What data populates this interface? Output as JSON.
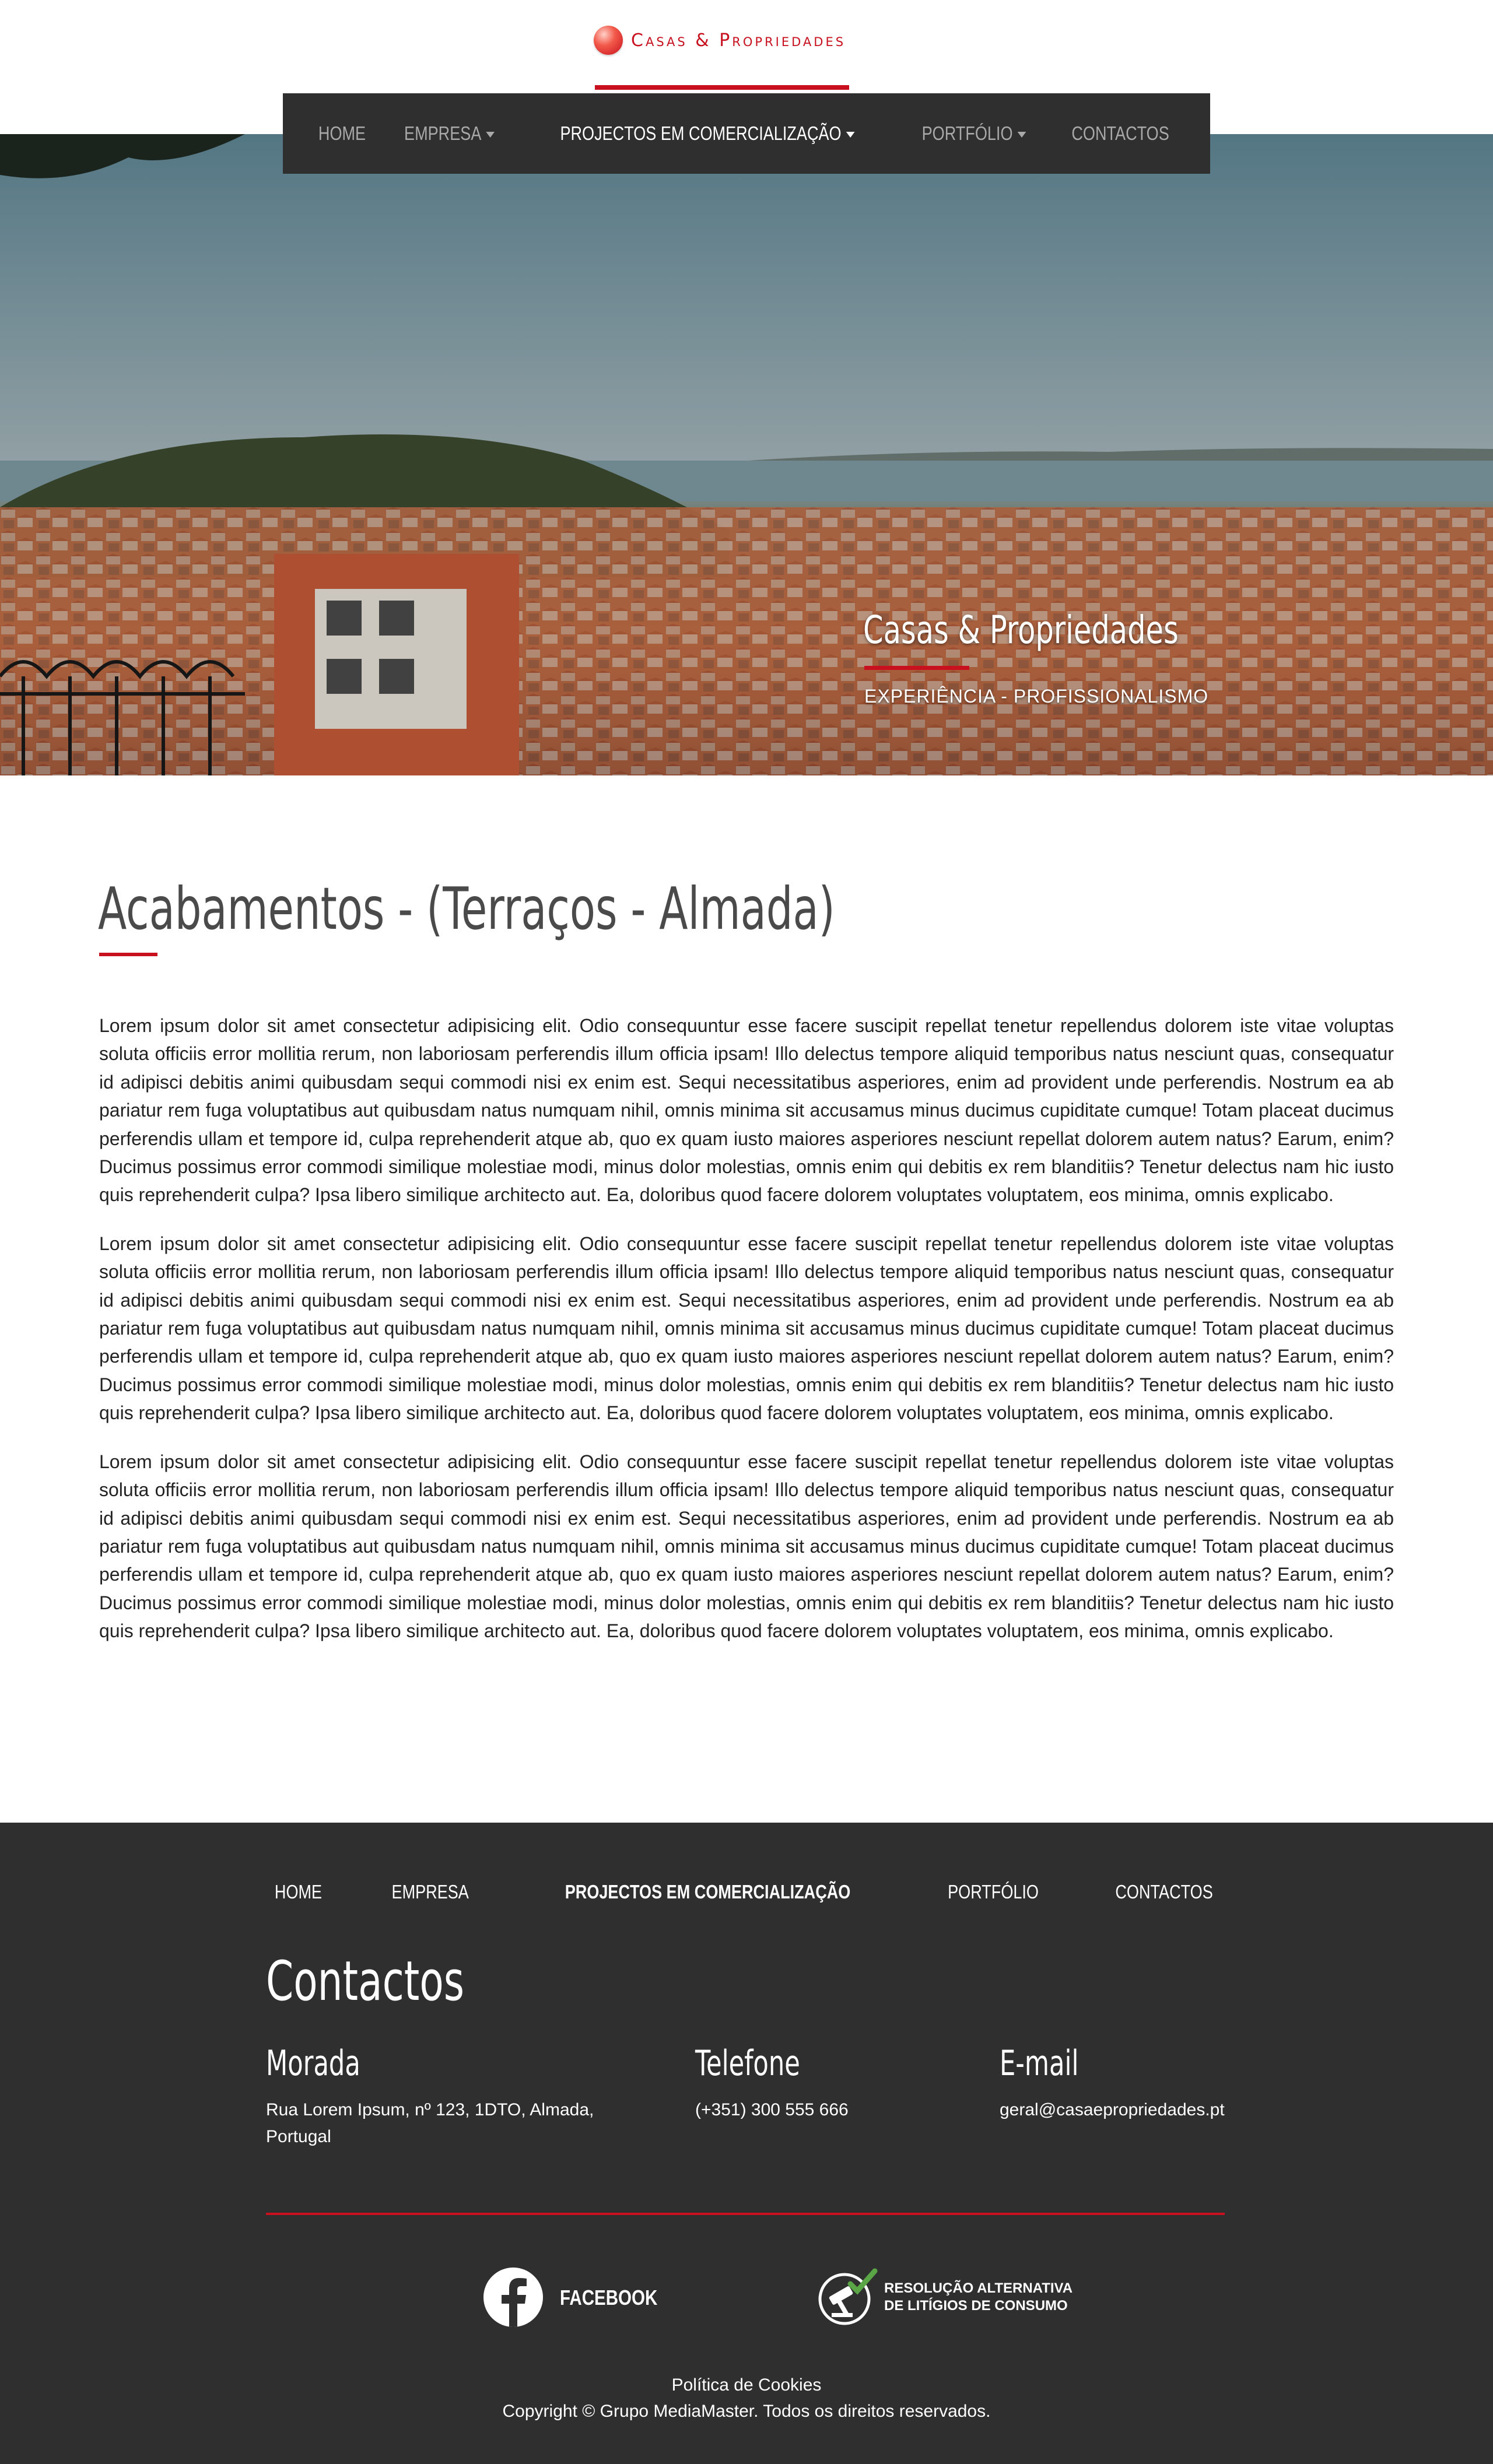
{
  "header": {
    "logo_text": "Casas & Propriedades"
  },
  "nav": {
    "items": [
      {
        "label": "HOME",
        "has_dropdown": false,
        "active": false
      },
      {
        "label": "EMPRESA",
        "has_dropdown": true,
        "active": false
      },
      {
        "label": "PROJECTOS EM COMERCIALIZAÇÃO",
        "has_dropdown": true,
        "active": true
      },
      {
        "label": "PORTFÓLIO",
        "has_dropdown": true,
        "active": false
      },
      {
        "label": "CONTACTOS",
        "has_dropdown": false,
        "active": false
      }
    ]
  },
  "hero": {
    "title": "Casas & Propriedades",
    "subtitle": "EXPERIÊNCIA - PROFISSIONALISMO"
  },
  "main": {
    "title": "Acabamentos - (Terraços - Almada)",
    "paragraphs": [
      "Lorem ipsum dolor sit amet consectetur adipisicing elit. Odio consequuntur esse facere suscipit repellat tenetur repellendus dolorem iste vitae voluptas soluta officiis error mollitia rerum, non laboriosam perferendis illum officia ipsam! Illo delectus tempore aliquid temporibus natus nesciunt quas, consequatur id adipisci debitis animi quibusdam sequi commodi nisi ex enim est. Sequi necessitatibus asperiores, enim ad provident unde perferendis. Nostrum ea ab pariatur rem fuga voluptatibus aut quibusdam natus numquam nihil, omnis minima sit accusamus minus ducimus cupiditate cumque! Totam placeat ducimus perferendis ullam et tempore id, culpa reprehenderit atque ab, quo ex quam iusto maiores asperiores nesciunt repellat dolorem autem natus? Earum, enim? Ducimus possimus error commodi similique molestiae modi, minus dolor molestias, omnis enim qui debitis ex rem blanditiis? Tenetur delectus nam hic iusto quis reprehenderit culpa? Ipsa libero similique architecto aut. Ea, doloribus quod facere dolorem voluptates voluptatem, eos minima, omnis explicabo.",
      "Lorem ipsum dolor sit amet consectetur adipisicing elit. Odio consequuntur esse facere suscipit repellat tenetur repellendus dolorem iste vitae voluptas soluta officiis error mollitia rerum, non laboriosam perferendis illum officia ipsam! Illo delectus tempore aliquid temporibus natus nesciunt quas, consequatur id adipisci debitis animi quibusdam sequi commodi nisi ex enim est. Sequi necessitatibus asperiores, enim ad provident unde perferendis. Nostrum ea ab pariatur rem fuga voluptatibus aut quibusdam natus numquam nihil, omnis minima sit accusamus minus ducimus cupiditate cumque! Totam placeat ducimus perferendis ullam et tempore id, culpa reprehenderit atque ab, quo ex quam iusto maiores asperiores nesciunt repellat dolorem autem natus? Earum, enim? Ducimus possimus error commodi similique molestiae modi, minus dolor molestias, omnis enim qui debitis ex rem blanditiis? Tenetur delectus nam hic iusto quis reprehenderit culpa? Ipsa libero similique architecto aut. Ea, doloribus quod facere dolorem voluptates voluptatem, eos minima, omnis explicabo.",
      "Lorem ipsum dolor sit amet consectetur adipisicing elit. Odio consequuntur esse facere suscipit repellat tenetur repellendus dolorem iste vitae voluptas soluta officiis error mollitia rerum, non laboriosam perferendis illum officia ipsam! Illo delectus tempore aliquid temporibus natus nesciunt quas, consequatur id adipisci debitis animi quibusdam sequi commodi nisi ex enim est. Sequi necessitatibus asperiores, enim ad provident unde perferendis. Nostrum ea ab pariatur rem fuga voluptatibus aut quibusdam natus numquam nihil, omnis minima sit accusamus minus ducimus cupiditate cumque! Totam placeat ducimus perferendis ullam et tempore id, culpa reprehenderit atque ab, quo ex quam iusto maiores asperiores nesciunt repellat dolorem autem natus? Earum, enim? Ducimus possimus error commodi similique molestiae modi, minus dolor molestias, omnis enim qui debitis ex rem blanditiis? Tenetur delectus nam hic iusto quis reprehenderit culpa? Ipsa libero similique architecto aut. Ea, doloribus quod facere dolorem voluptates voluptatem, eos minima, omnis explicabo."
    ]
  },
  "footer": {
    "nav": [
      {
        "label": "HOME",
        "bold": false
      },
      {
        "label": "EMPRESA",
        "bold": false
      },
      {
        "label": "PROJECTOS EM COMERCIALIZAÇÃO",
        "bold": true
      },
      {
        "label": "PORTFÓLIO",
        "bold": false
      },
      {
        "label": "CONTACTOS",
        "bold": false
      }
    ],
    "contacts_title": "Contactos",
    "address_heading": "Morada",
    "address_line1": "Rua Lorem Ipsum, nº 123, 1DTO, Almada,",
    "address_line2": "Portugal",
    "phone_heading": "Telefone",
    "phone": "(+351) 300 555 666",
    "email_heading": "E-mail",
    "email": "geral@casaepropriedades.pt",
    "facebook_label": "FACEBOOK",
    "ral_line1": "RESOLUÇÃO ALTERNATIVA",
    "ral_line2": "DE LITÍGIOS DE CONSUMO",
    "cookies": "Política de Cookies",
    "copyright": "Copyright © Grupo MediaMaster. Todos os direitos reservados."
  },
  "icons": {
    "logo": "logo-sphere-icon",
    "dropdown": "caret-down-icon",
    "facebook": "facebook-icon",
    "ral": "gavel-check-icon"
  },
  "colors": {
    "accent": "#c8101e",
    "dark": "#2f2f2f",
    "nav_inactive": "#a9a9a9",
    "text": "#222222"
  }
}
